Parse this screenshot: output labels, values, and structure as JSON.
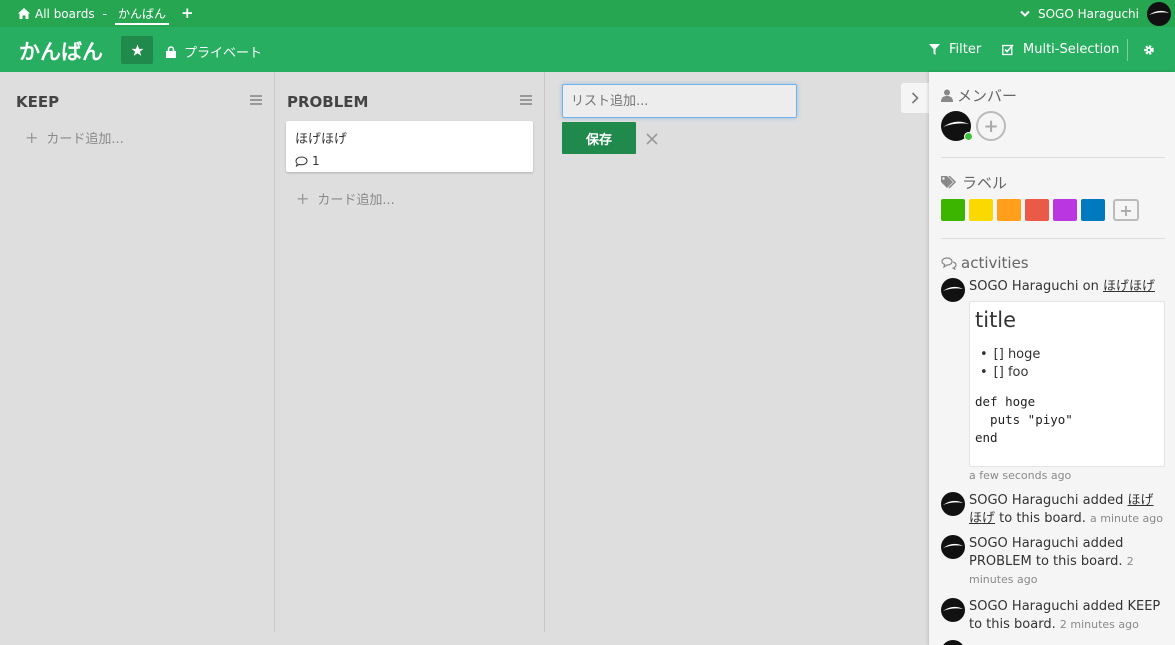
{
  "topnav": {
    "all_boards": "All boards",
    "separator": "-",
    "current_board": "かんばん",
    "add": "+",
    "user_name": "SOGO Haraguchi"
  },
  "header": {
    "title": "かんばん",
    "privacy": "プライベート",
    "filter": "Filter",
    "multi_selection": "Multi-Selection"
  },
  "lists": [
    {
      "title": "KEEP",
      "add_card": "カード追加..."
    },
    {
      "title": "PROBLEM",
      "add_card": "カード追加...",
      "cards": [
        {
          "title": "ほげほげ",
          "comments": "1"
        }
      ]
    }
  ],
  "new_list": {
    "placeholder": "リスト追加...",
    "save": "保存"
  },
  "sidebar": {
    "members_title": "メンバー",
    "labels_title": "ラベル",
    "activities_title": "activities",
    "label_colors": [
      "#3cb500",
      "#fad900",
      "#ff9f1a",
      "#eb5a46",
      "#c377e0",
      "#0079bf"
    ],
    "activities": [
      {
        "user": "SOGO Haraguchi",
        "verb": "on",
        "target": "ほげほげ",
        "comment": {
          "title": "title",
          "items": [
            "[] hoge",
            "[] foo"
          ],
          "code": "def hoge\n  puts \"piyo\"\nend"
        },
        "time": "a few seconds ago"
      },
      {
        "user": "SOGO Haraguchi",
        "verb": "added",
        "target_1": "ほげ",
        "target_2": "ほげ",
        "rest": "to this board.",
        "time": "a minute ago"
      },
      {
        "user": "SOGO Haraguchi",
        "verb": "added",
        "target": "PROBLEM",
        "rest": "to this board.",
        "time_1": "2",
        "time_2": "minutes ago"
      },
      {
        "user": "SOGO Haraguchi",
        "verb": "added",
        "target": "KEEP",
        "rest": "to this board.",
        "time": "2 minutes ago"
      }
    ]
  }
}
